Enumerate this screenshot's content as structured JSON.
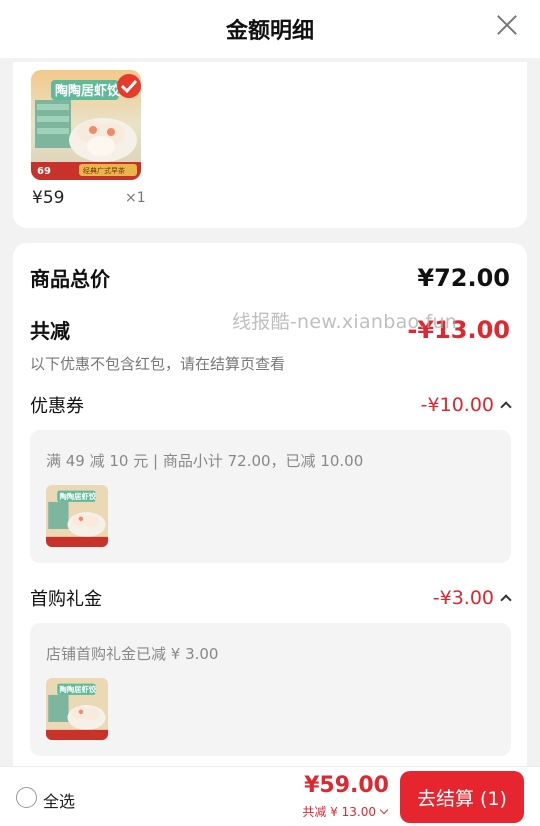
{
  "header": {
    "title": "金额明细"
  },
  "product": {
    "price": "¥59",
    "qty": "×1"
  },
  "summary": {
    "total_label": "商品总价",
    "total_value": "¥72.00",
    "discount_label": "共减",
    "discount_value": "-¥13.00",
    "note": "以下优惠不包含红包，请在结算页查看"
  },
  "coupon": {
    "label": "优惠券",
    "value": "-¥10.00",
    "detail": "满 49 减 10 元 | 商品小计 72.00，已减 10.00"
  },
  "first_purchase": {
    "label": "首购礼金",
    "value": "-¥3.00",
    "detail": "店铺首购礼金已减 ¥ 3.00"
  },
  "watermark": "线报酷-new.xianbao.fun",
  "footer": {
    "select_all": "全选",
    "total": "¥59.00",
    "total_sub": "共减 ¥ 13.00",
    "checkout": "去结算 (1)"
  },
  "colors": {
    "accent": "#e0262e",
    "checkout_bg": "#e6252e"
  },
  "icons": {
    "close": "close-icon",
    "expand": "chevron-up-icon",
    "radio": "radio-icon",
    "collapse": "chevron-down-icon"
  }
}
